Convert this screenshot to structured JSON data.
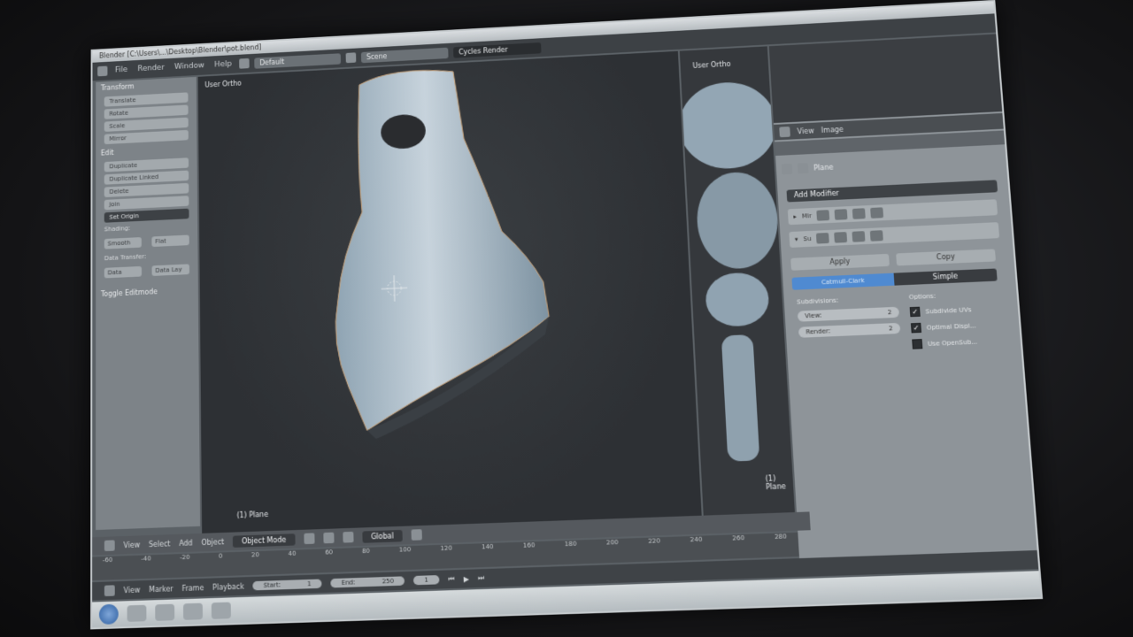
{
  "window": {
    "title": "Blender [C:\\Users\\...\\Desktop\\Blender\\pot.blend]"
  },
  "info_header": {
    "menus": [
      "File",
      "Render",
      "Window",
      "Help"
    ],
    "layout": "Default",
    "scene": "Scene",
    "engine": "Cycles Render"
  },
  "tool_shelf": {
    "transform_heading": "Transform",
    "transform_buttons": [
      "Translate",
      "Rotate",
      "Scale",
      "Mirror"
    ],
    "edit_heading": "Edit",
    "edit_buttons": [
      "Duplicate",
      "Duplicate Linked",
      "Delete",
      "Join"
    ],
    "set_origin": "Set Origin",
    "shading_label": "Shading:",
    "shading_buttons": [
      "Smooth",
      "Flat"
    ],
    "data_transfer_label": "Data Transfer:",
    "data_buttons": [
      "Data",
      "Data Lay"
    ],
    "toggle_label": "Toggle Editmode"
  },
  "viewport": {
    "view_label": "User Ortho",
    "object_label": "(1) Plane"
  },
  "viewport2": {
    "view_label": "User Ortho",
    "object_label": "(1) Plane"
  },
  "view3d_header": {
    "menus": [
      "View",
      "Select",
      "Add",
      "Object"
    ],
    "mode": "Object Mode",
    "orientation": "Global"
  },
  "properties": {
    "header_tabs": [
      "View",
      "Image"
    ],
    "object_name": "Plane",
    "add_modifier": "Add Modifier",
    "modifier1_short": "Mir",
    "modifier2_short": "Su",
    "apply": "Apply",
    "copy": "Copy",
    "algo_catmull": "Catmull-Clark",
    "algo_simple": "Simple",
    "subdivisions_label": "Subdivisions:",
    "view_field": {
      "label": "View:",
      "value": "2"
    },
    "render_field": {
      "label": "Render:",
      "value": "2"
    },
    "options_label": "Options:",
    "opt_subdivide_uvs": "Subdivide UVs",
    "opt_optimal_display": "Optimal Displ...",
    "opt_opensubdiv": "Use OpenSub...",
    "opt_states": [
      true,
      true,
      false
    ]
  },
  "timeline": {
    "ticks": [
      "-60",
      "-40",
      "-20",
      "0",
      "20",
      "40",
      "60",
      "80",
      "100",
      "120",
      "140",
      "160",
      "180",
      "200",
      "220",
      "240",
      "260",
      "280"
    ],
    "menus": [
      "View",
      "Marker",
      "Frame",
      "Playback"
    ],
    "start": {
      "label": "Start:",
      "value": "1"
    },
    "end": {
      "label": "End:",
      "value": "250"
    },
    "current": "1"
  },
  "colors": {
    "accent_blue": "#4f8ad1",
    "panel_grey": "#8e9499",
    "viewport_bg": "#2d3034"
  }
}
